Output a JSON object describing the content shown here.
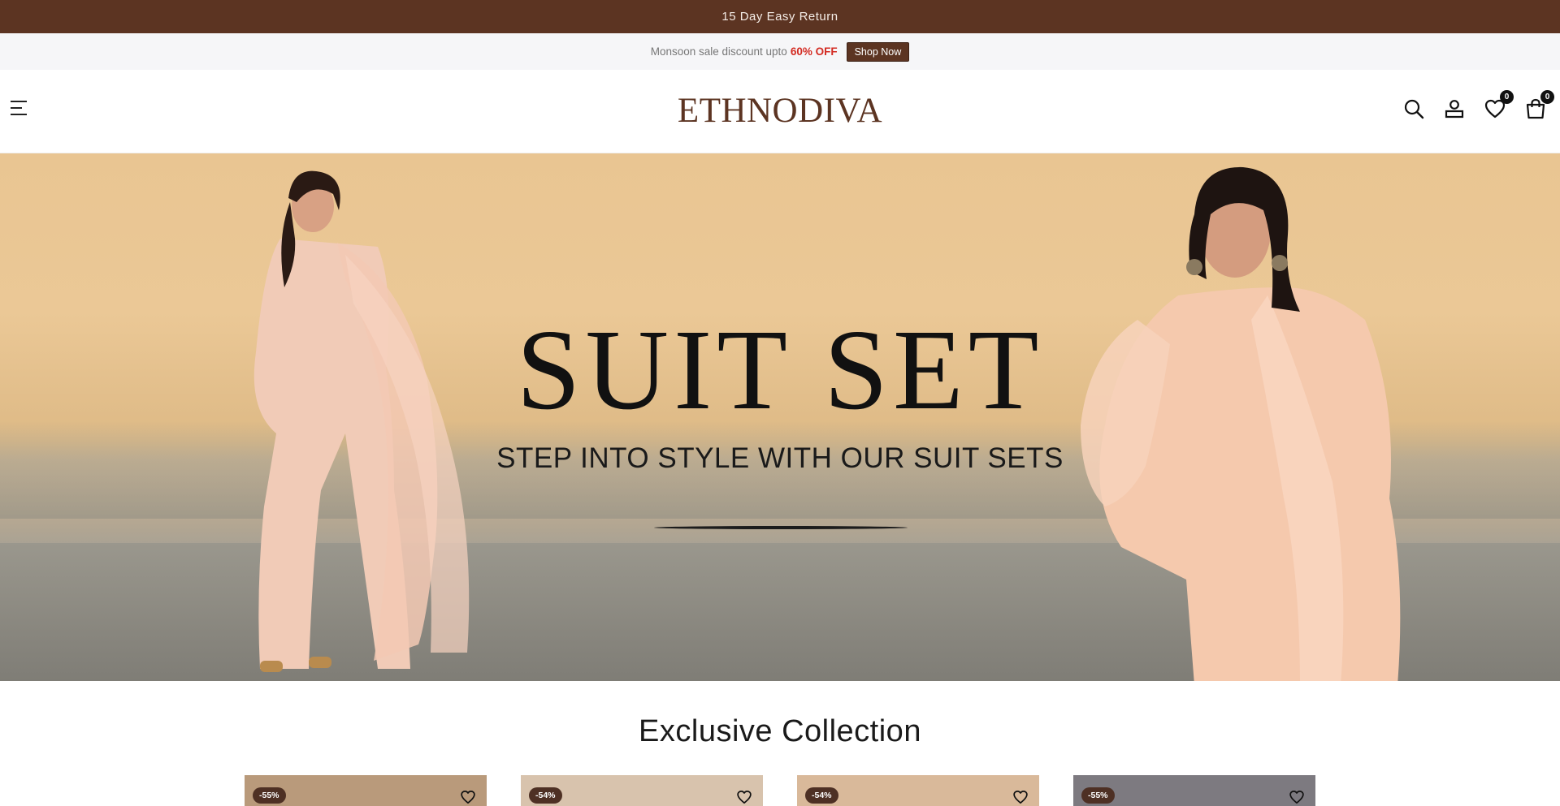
{
  "announcement": {
    "text": "15 Day Easy Return"
  },
  "promo": {
    "text": "Monsoon sale discount upto",
    "discount": "60% OFF",
    "button": "Shop Now"
  },
  "header": {
    "logo": "ETHNODIVA",
    "icons": [
      "menu-icon",
      "search-icon",
      "account-icon",
      "heart-icon",
      "cart-icon"
    ],
    "wishlist_count": "0",
    "cart_count": "0"
  },
  "hero": {
    "title": "SUIT SET",
    "subtitle": "STEP INTO STYLE WITH OUR SUIT SETS"
  },
  "collection": {
    "title": "Exclusive Collection",
    "products": [
      {
        "discount": "-55%",
        "bg": "#b99a7b"
      },
      {
        "discount": "-54%",
        "bg": "#d8c3ad"
      },
      {
        "discount": "-54%",
        "bg": "#d9b99a"
      },
      {
        "discount": "-55%",
        "bg": "#7d7a80"
      }
    ]
  },
  "colors": {
    "brand": "#5c3422",
    "accent": "#d32b22"
  }
}
